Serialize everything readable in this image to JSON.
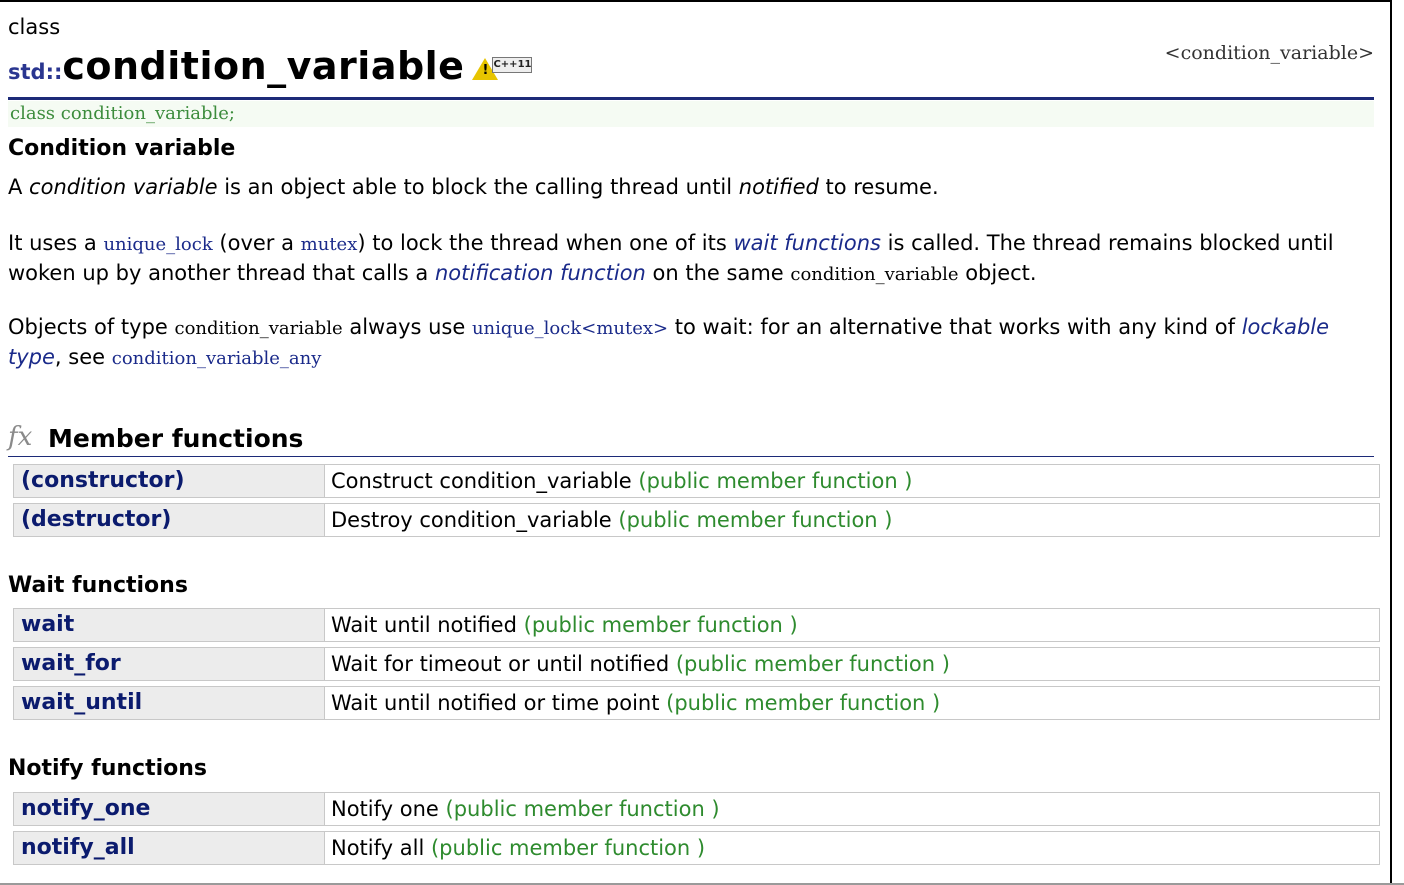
{
  "header": {
    "kind": "class",
    "namespace": "std::",
    "name": "condition_variable",
    "badge_label": "C++11",
    "header_file": "<condition_variable>"
  },
  "declaration": "class condition_variable;",
  "subtitle": "Condition variable",
  "paragraphs": {
    "p1": {
      "t1": "A ",
      "em1": "condition variable",
      "t2": " is an object able to block the calling thread until ",
      "em2": "notified",
      "t3": " to resume."
    },
    "p2": {
      "t1": "It uses a ",
      "c1": "unique_lock",
      "t2": " (over a ",
      "c2": "mutex",
      "t3": ") to lock the thread when one of its ",
      "k1": "wait functions",
      "t4": " is called. The thread remains blocked until woken up by another thread that calls a ",
      "k2": "notification function",
      "t5": " on the same ",
      "c3": "condition_variable",
      "t6": " object."
    },
    "p3": {
      "t1": "Objects of type ",
      "c1": "condition_variable",
      "t2": " always use ",
      "c2": "unique_lock<mutex>",
      "t3": " to wait: for an alternative that works with any kind of ",
      "k1": "lockable type",
      "t4": ", see ",
      "c3": "condition_variable_any"
    }
  },
  "members_section": {
    "icon": "fx",
    "title": "Member functions"
  },
  "groups": {
    "basic": {
      "title": "",
      "rows": [
        {
          "name": "(constructor)",
          "desc": "Construct condition_variable",
          "type": "(public member function )"
        },
        {
          "name": "(destructor)",
          "desc": "Destroy condition_variable",
          "type": "(public member function )"
        }
      ]
    },
    "wait": {
      "title": "Wait functions",
      "rows": [
        {
          "name": "wait",
          "desc": "Wait until notified",
          "type": "(public member function )"
        },
        {
          "name": "wait_for",
          "desc": "Wait for timeout or until notified",
          "type": "(public member function )"
        },
        {
          "name": "wait_until",
          "desc": "Wait until notified or time point",
          "type": "(public member function )"
        }
      ]
    },
    "notify": {
      "title": "Notify functions",
      "rows": [
        {
          "name": "notify_one",
          "desc": "Notify one",
          "type": "(public member function )"
        },
        {
          "name": "notify_all",
          "desc": "Notify all",
          "type": "(public member function )"
        }
      ]
    }
  }
}
